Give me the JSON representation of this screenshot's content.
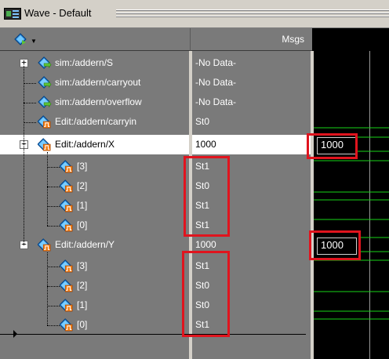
{
  "window": {
    "title": "Wave - Default"
  },
  "header": {
    "msgs_label": "Msgs"
  },
  "signals": [
    {
      "name": "sim:/addern/S",
      "value": "-No Data-",
      "kind": "sim",
      "expander": "+",
      "child": false
    },
    {
      "name": "sim:/addern/carryout",
      "value": "-No Data-",
      "kind": "sim",
      "expander": "",
      "child": false
    },
    {
      "name": "sim:/addern/overflow",
      "value": "-No Data-",
      "kind": "sim",
      "expander": "",
      "child": false
    },
    {
      "name": "Edit:/addern/carryin",
      "value": "St0",
      "kind": "edit",
      "expander": "",
      "child": false
    },
    {
      "name": "Edit:/addern/X",
      "value": "1000",
      "kind": "edit",
      "expander": "−",
      "child": false,
      "selected": true
    },
    {
      "name": "[3]",
      "value": "St1",
      "kind": "edit",
      "expander": "",
      "child": true
    },
    {
      "name": "[2]",
      "value": "St0",
      "kind": "edit",
      "expander": "",
      "child": true
    },
    {
      "name": "[1]",
      "value": "St1",
      "kind": "edit",
      "expander": "",
      "child": true
    },
    {
      "name": "[0]",
      "value": "St1",
      "kind": "edit",
      "expander": "",
      "child": true
    },
    {
      "name": "Edit:/addern/Y",
      "value": "1000",
      "kind": "edit",
      "expander": "−",
      "child": false
    },
    {
      "name": "[3]",
      "value": "St1",
      "kind": "edit",
      "expander": "",
      "child": true
    },
    {
      "name": "[2]",
      "value": "St0",
      "kind": "edit",
      "expander": "",
      "child": true
    },
    {
      "name": "[1]",
      "value": "St0",
      "kind": "edit",
      "expander": "",
      "child": true
    },
    {
      "name": "[0]",
      "value": "St1",
      "kind": "edit",
      "expander": "",
      "child": true
    }
  ],
  "wave_values": {
    "x_bus": "1000",
    "y_bus": "1000"
  },
  "colors": {
    "pane_bg": "#7a7a7a",
    "wave_bg": "#000000",
    "wave_green": "#18d418",
    "highlight": "#e0141e",
    "cursor": "#9a9a9a"
  },
  "icons": {
    "tool": "signal-diamond-dropdown-icon",
    "sim_signal": "sim-diamond-arrow-icon",
    "edit_signal": "edit-diamond-pulse-icon"
  }
}
